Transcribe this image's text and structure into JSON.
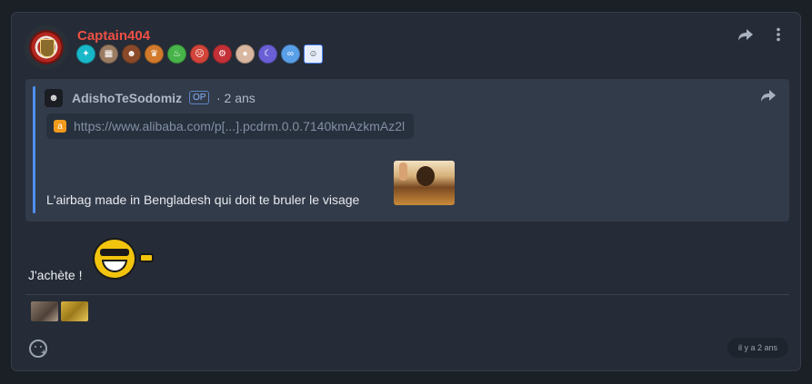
{
  "post": {
    "username": "Captain404",
    "badges": [
      {
        "icon": "crystal-icon",
        "glyph": "✦",
        "color": "#18b8c9"
      },
      {
        "icon": "cube-icon",
        "glyph": "▦",
        "color": "#9a7c62"
      },
      {
        "icon": "face-icon",
        "glyph": "☻",
        "color": "#8a4a2a"
      },
      {
        "icon": "trophy-icon",
        "glyph": "♛",
        "color": "#d17a2c"
      },
      {
        "icon": "beer-icon",
        "glyph": "♨",
        "color": "#47b44a"
      },
      {
        "icon": "monster-icon",
        "glyph": "☹",
        "color": "#d2443a"
      },
      {
        "icon": "robot-icon",
        "glyph": "⚙",
        "color": "#c43037"
      },
      {
        "icon": "pig-icon",
        "glyph": "●",
        "color": "#d8b6a0"
      },
      {
        "icon": "moon-icon",
        "glyph": "☾",
        "color": "#6a5fd6"
      },
      {
        "icon": "glasses-icon",
        "glyph": "∞",
        "color": "#5aa0e8"
      },
      {
        "icon": "smiley-icon",
        "glyph": "☺",
        "color": "#f5c518"
      }
    ],
    "quote": {
      "author": "AdishoTeSodomiz",
      "op_label": "OP",
      "time": "· 2 ans",
      "link": "https://www.alibaba.com/p[...].pcdrm.0.0.7140kmAzkmAz2l",
      "text": "L'airbag made in Bengladesh qui doit te bruler le visage"
    },
    "text": "J'achète !",
    "timestamp": "il y a 2 ans"
  }
}
